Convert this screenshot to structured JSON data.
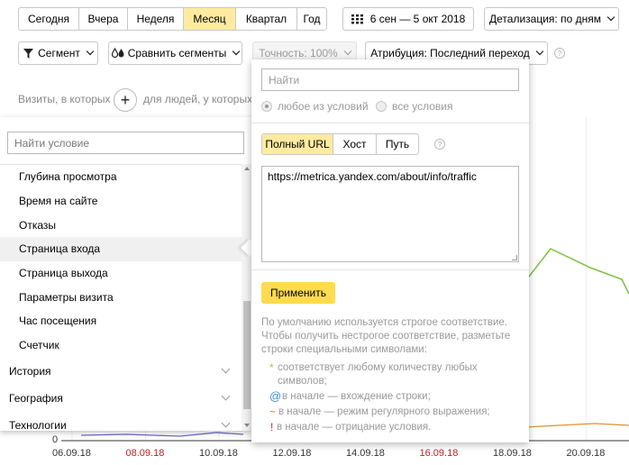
{
  "toolbar": {
    "periods": [
      {
        "label": "Сегодня",
        "active": false
      },
      {
        "label": "Вчера",
        "active": false
      },
      {
        "label": "Неделя",
        "active": false
      },
      {
        "label": "Месяц",
        "active": true
      },
      {
        "label": "Квартал",
        "active": false
      },
      {
        "label": "Год",
        "active": false
      }
    ],
    "date_range": "6 сен — 5 окт 2018",
    "detail": "Детализация: по дням"
  },
  "toolbar2": {
    "segment": "Сегмент",
    "compare": "Сравнить сегменты",
    "accuracy": "Точность: 100%",
    "attribution": "Атрибуция: Последний переход"
  },
  "segment_bar": {
    "visits_label": "Визиты, в которых",
    "people_label": "для людей, у которых"
  },
  "left_panel": {
    "search_placeholder": "Найти условие",
    "items": [
      "Глубина просмотра",
      "Время на сайте",
      "Отказы",
      "Страница входа",
      "Страница выхода",
      "Параметры визита",
      "Час посещения",
      "Счетчик"
    ],
    "selected_index": 3,
    "groups": [
      "История",
      "География",
      "Технологии"
    ]
  },
  "popup": {
    "search_placeholder": "Найти",
    "radio_any": "любое из условий",
    "radio_all": "все условия",
    "match_tabs": [
      "Полный URL",
      "Хост",
      "Путь"
    ],
    "active_tab": 0,
    "url_value": "https://metrica.yandex.com/about/info/traffic",
    "apply": "Применить",
    "hint_1": "По умолчанию используется строгое соответствие. Чтобы получить нестрогое соответствие, разметьте строки специальными символами:",
    "rules": [
      {
        "symbol": "*",
        "text": "соответствует любому количеству любых символов;",
        "color": "#9ac73a"
      },
      {
        "symbol": "@",
        "text": "в начале — вхождение строки;",
        "color": "#3d8ee0"
      },
      {
        "symbol": "~",
        "text": "в начале — режим регулярного выражения;",
        "color": "#e07020"
      },
      {
        "symbol": "!",
        "text": "в начале — отрицание условия.",
        "color": "#d02828"
      }
    ]
  },
  "chart_data": {
    "type": "line",
    "x_ticks": [
      "06.09.18",
      "08.09.18",
      "10.09.18",
      "12.09.18",
      "14.09.18",
      "16.09.18",
      "18.09.18",
      "20.09.18"
    ],
    "weekend_ticks": [
      "08.09.18",
      "16.09.18"
    ],
    "y_tick": "0",
    "series_color": "#7cc040"
  },
  "colors": {
    "accent": "#ffdb4d",
    "active_tab": "#ffeba0"
  }
}
